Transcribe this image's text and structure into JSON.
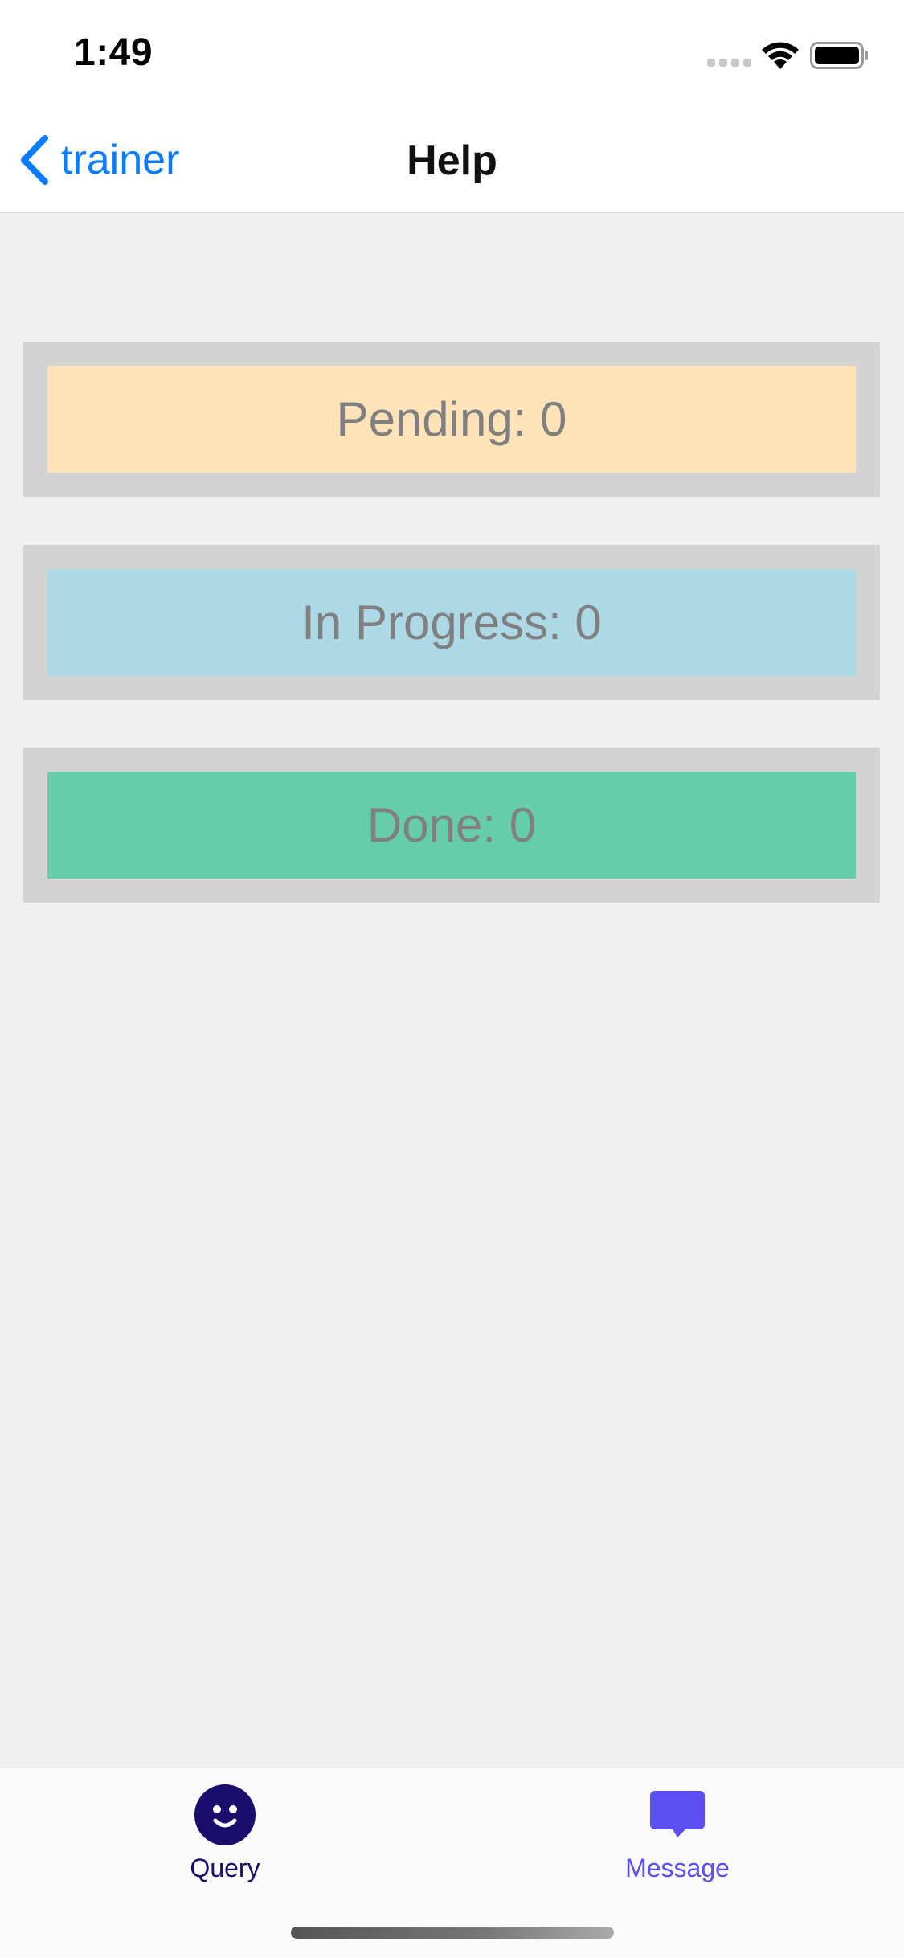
{
  "status_bar": {
    "time": "1:49"
  },
  "nav": {
    "back_label": "trainer",
    "title": "Help"
  },
  "cards": [
    {
      "label": "Pending: 0",
      "color": "#fde3b7"
    },
    {
      "label": "In Progress: 0",
      "color": "#add8e6"
    },
    {
      "label": "Done: 0",
      "color": "#66cdaa"
    }
  ],
  "tabs": [
    {
      "label": "Query",
      "icon": "smiley-icon",
      "active": true,
      "color": "#1a0d6b"
    },
    {
      "label": "Message",
      "icon": "chat-bubble-icon",
      "active": false,
      "color": "#5b4ff2"
    }
  ]
}
